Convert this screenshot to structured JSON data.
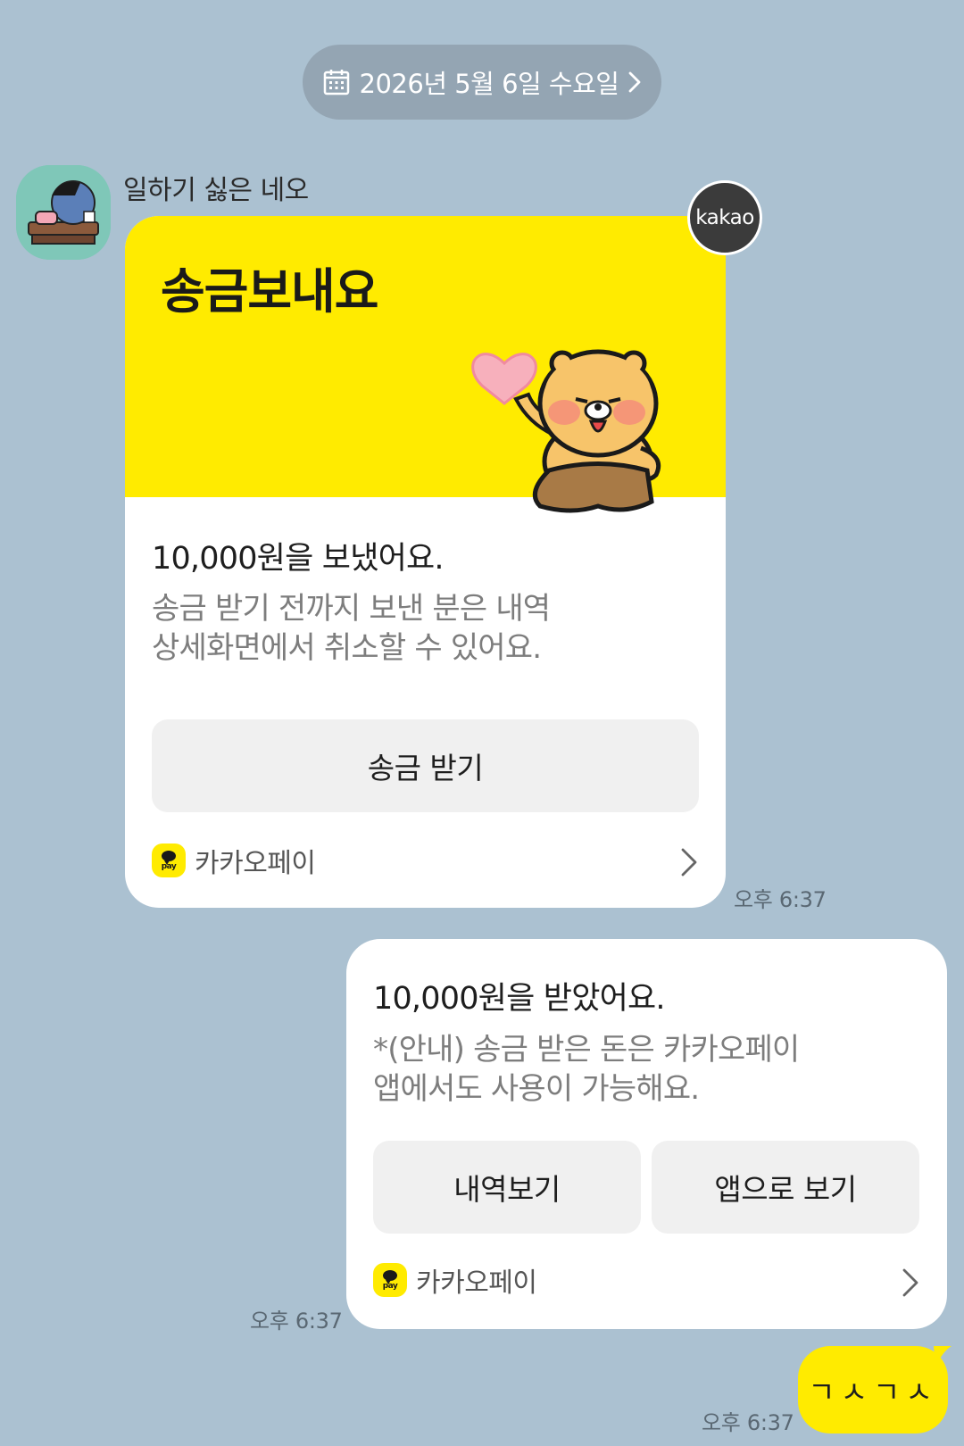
{
  "date_header": {
    "label": "2026년 5월 6일 수요일",
    "icon": "calendar-icon",
    "chevron": "chevron-right-icon"
  },
  "sender": {
    "name": "일하기 싫은 네오"
  },
  "received_card": {
    "badge": "kakao",
    "title": "송금보내요",
    "heading": "10,000원을 보냈어요.",
    "desc_line1": "송금 받기 전까지 보낸 분은 내역",
    "desc_line2": "상세화면에서 취소할 수 있어요.",
    "button": "송금 받기",
    "footer": "카카오페이",
    "time": "오후 6:37"
  },
  "sent_card": {
    "heading": "10,000원을 받았어요.",
    "desc_line1": "*(안내) 송금 받은 돈은 카카오페이",
    "desc_line2": "앱에서도 사용이 가능해요.",
    "button_history": "내역보기",
    "button_app": "앱으로 보기",
    "footer": "카카오페이",
    "time": "오후 6:37"
  },
  "sent_message": {
    "text": "ㄱㅅㄱㅅ",
    "time": "오후 6:37"
  },
  "colors": {
    "background": "#abc1d1",
    "kakao_yellow": "#ffeb00",
    "date_pill": "#94a5b3"
  }
}
